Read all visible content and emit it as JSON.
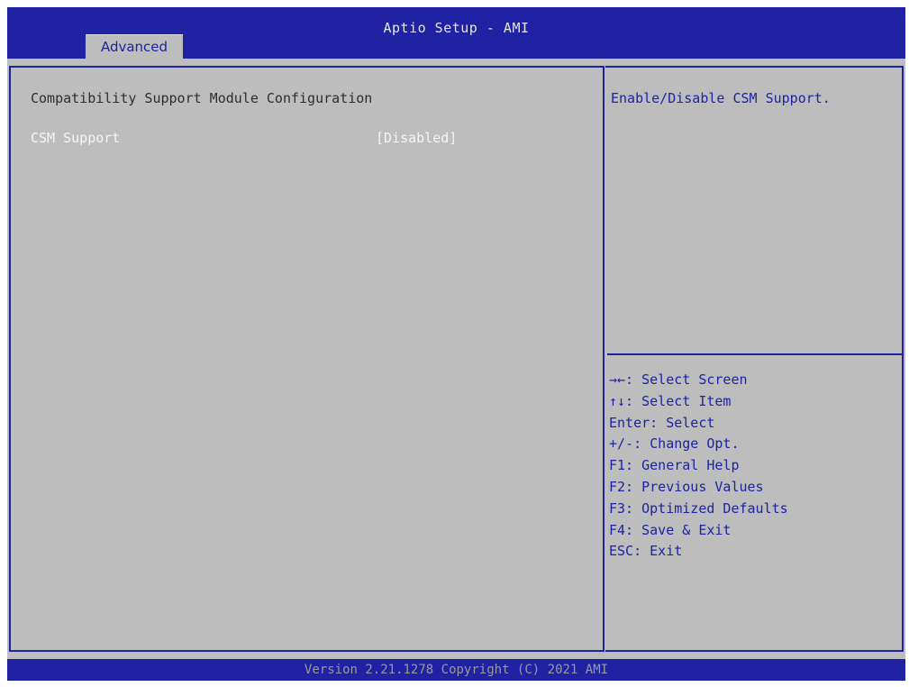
{
  "header": {
    "title": "Aptio Setup - AMI",
    "tab_label": "Advanced"
  },
  "main": {
    "section_title": "Compatibility Support Module Configuration",
    "settings": [
      {
        "label": "CSM Support",
        "value": "[Disabled]"
      }
    ]
  },
  "help": {
    "description": "Enable/Disable CSM Support.",
    "keys": [
      "→←: Select Screen",
      "↑↓: Select Item",
      "Enter: Select",
      "+/-: Change Opt.",
      "F1: General Help",
      "F2: Previous Values",
      "F3: Optimized Defaults",
      "F4: Save & Exit",
      "ESC: Exit"
    ]
  },
  "footer": {
    "text": "Version 2.21.1278 Copyright (C) 2021 AMI"
  },
  "colors": {
    "bios_blue": "#1e22a3",
    "panel_gray": "#bdbdbd",
    "selected_text": "#f4f4f4",
    "heading_text": "#2e2e2e"
  }
}
